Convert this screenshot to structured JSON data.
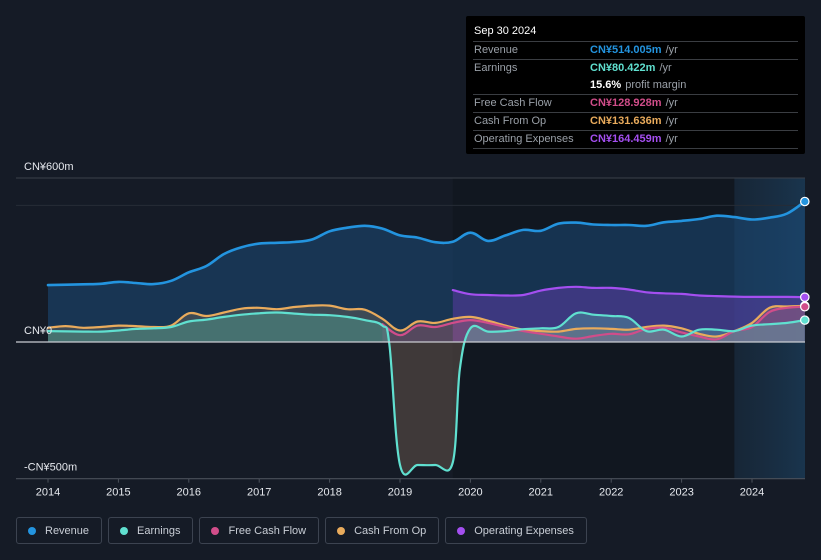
{
  "tooltip": {
    "date": "Sep 30 2024",
    "rows": [
      {
        "label": "Revenue",
        "value": "CN¥514.005m",
        "unit": "/yr",
        "color": "#2394df"
      },
      {
        "label": "Earnings",
        "value": "CN¥80.422m",
        "unit": "/yr",
        "color": "#60e0d0"
      },
      {
        "label": "",
        "margin_value": "15.6%",
        "margin_text": "profit margin"
      },
      {
        "label": "Free Cash Flow",
        "value": "CN¥128.928m",
        "unit": "/yr",
        "color": "#d14d8a"
      },
      {
        "label": "Cash From Op",
        "value": "CN¥131.636m",
        "unit": "/yr",
        "color": "#e9ab5c"
      },
      {
        "label": "Operating Expenses",
        "value": "CN¥164.459m",
        "unit": "/yr",
        "color": "#a44ff0"
      }
    ]
  },
  "legend": [
    {
      "label": "Revenue",
      "color": "#2394df"
    },
    {
      "label": "Earnings",
      "color": "#60e0d0"
    },
    {
      "label": "Free Cash Flow",
      "color": "#d14d8a"
    },
    {
      "label": "Cash From Op",
      "color": "#e9ab5c"
    },
    {
      "label": "Operating Expenses",
      "color": "#a44ff0"
    }
  ],
  "chart_data": {
    "type": "area",
    "title": "",
    "xlabel": "",
    "ylabel": "",
    "y_tick_labels": [
      {
        "value": 600,
        "label": "CN¥600m"
      },
      {
        "value": 0,
        "label": "CN¥0"
      },
      {
        "value": -500,
        "label": "-CN¥500m"
      }
    ],
    "ylim": [
      -500,
      600
    ],
    "xlim": [
      2013.97,
      2024.75
    ],
    "x_tick_labels": [
      "2014",
      "2015",
      "2016",
      "2017",
      "2018",
      "2019",
      "2020",
      "2021",
      "2022",
      "2023",
      "2024"
    ],
    "x_ticks": [
      2014,
      2015,
      2016,
      2017,
      2018,
      2019,
      2020,
      2021,
      2022,
      2023,
      2024
    ],
    "forecast_shade_start": 2023.75,
    "grid": true,
    "legend_position": "bottom",
    "series": [
      {
        "name": "Revenue",
        "color": "#2394df",
        "x": [
          2014.0,
          2014.5,
          2014.75,
          2015.0,
          2015.25,
          2015.5,
          2015.75,
          2016.0,
          2016.25,
          2016.5,
          2016.75,
          2017.0,
          2017.25,
          2017.5,
          2017.75,
          2018.0,
          2018.25,
          2018.5,
          2018.75,
          2019.0,
          2019.25,
          2019.5,
          2019.75,
          2020.0,
          2020.25,
          2020.5,
          2020.75,
          2021.0,
          2021.25,
          2021.5,
          2021.75,
          2022.0,
          2022.25,
          2022.5,
          2022.75,
          2023.0,
          2023.25,
          2023.5,
          2023.75,
          2024.0,
          2024.25,
          2024.5,
          2024.75
        ],
        "values": [
          208,
          211,
          213,
          220,
          216,
          212,
          224,
          255,
          278,
          322,
          347,
          360,
          363,
          366,
          375,
          405,
          418,
          425,
          415,
          390,
          382,
          365,
          367,
          400,
          370,
          390,
          410,
          407,
          433,
          437,
          430,
          428,
          428,
          425,
          438,
          443,
          450,
          462,
          457,
          448,
          455,
          470,
          514
        ]
      },
      {
        "name": "Earnings",
        "color": "#60e0d0",
        "x": [
          2014.0,
          2014.5,
          2014.75,
          2015.0,
          2015.25,
          2015.5,
          2015.75,
          2016.0,
          2016.25,
          2016.5,
          2016.75,
          2017.0,
          2017.25,
          2017.5,
          2017.75,
          2018.0,
          2018.25,
          2018.5,
          2018.75,
          2018.85,
          2019.0,
          2019.25,
          2019.5,
          2019.75,
          2019.85,
          2020.0,
          2020.25,
          2020.5,
          2020.75,
          2021.0,
          2021.25,
          2021.5,
          2021.75,
          2022.0,
          2022.25,
          2022.5,
          2022.75,
          2023.0,
          2023.25,
          2023.5,
          2023.75,
          2024.0,
          2024.25,
          2024.5,
          2024.75
        ],
        "values": [
          40,
          38,
          38,
          42,
          48,
          50,
          55,
          75,
          82,
          92,
          100,
          105,
          108,
          104,
          100,
          98,
          92,
          80,
          60,
          -10,
          -450,
          -450,
          -450,
          -440,
          -100,
          50,
          38,
          40,
          47,
          50,
          55,
          105,
          100,
          95,
          88,
          40,
          45,
          20,
          45,
          45,
          40,
          60,
          65,
          70,
          80
        ]
      },
      {
        "name": "Free Cash Flow",
        "color": "#d14d8a",
        "x": [
          2018.75,
          2019.0,
          2019.25,
          2019.5,
          2019.75,
          2020.0,
          2020.25,
          2020.5,
          2020.75,
          2021.0,
          2021.25,
          2021.5,
          2021.75,
          2022.0,
          2022.25,
          2022.5,
          2022.75,
          2023.0,
          2023.25,
          2023.5,
          2023.75,
          2024.0,
          2024.25,
          2024.5,
          2024.75
        ],
        "values": [
          65,
          25,
          60,
          55,
          70,
          80,
          70,
          55,
          40,
          30,
          20,
          12,
          22,
          30,
          28,
          48,
          52,
          35,
          20,
          10,
          40,
          55,
          110,
          125,
          129
        ]
      },
      {
        "name": "Cash From Op",
        "color": "#e9ab5c",
        "x": [
          2014.0,
          2014.25,
          2014.5,
          2014.75,
          2015.0,
          2015.25,
          2015.5,
          2015.75,
          2016.0,
          2016.25,
          2016.5,
          2016.75,
          2017.0,
          2017.25,
          2017.5,
          2017.75,
          2018.0,
          2018.25,
          2018.5,
          2018.75,
          2019.0,
          2019.25,
          2019.5,
          2019.75,
          2020.0,
          2020.25,
          2020.5,
          2020.75,
          2021.0,
          2021.25,
          2021.5,
          2021.75,
          2022.0,
          2022.25,
          2022.5,
          2022.75,
          2023.0,
          2023.25,
          2023.5,
          2023.75,
          2024.0,
          2024.25,
          2024.5,
          2024.75
        ],
        "values": [
          52,
          58,
          52,
          55,
          60,
          58,
          55,
          60,
          105,
          95,
          108,
          122,
          125,
          120,
          128,
          133,
          133,
          120,
          118,
          85,
          42,
          75,
          70,
          85,
          92,
          78,
          60,
          45,
          40,
          38,
          48,
          50,
          48,
          45,
          55,
          60,
          50,
          30,
          20,
          40,
          70,
          125,
          130,
          132
        ]
      },
      {
        "name": "Operating Expenses",
        "color": "#a44ff0",
        "x": [
          2019.75,
          2020.0,
          2020.25,
          2020.5,
          2020.75,
          2021.0,
          2021.25,
          2021.5,
          2021.75,
          2022.0,
          2022.25,
          2022.5,
          2022.75,
          2023.0,
          2023.25,
          2023.5,
          2023.75,
          2024.0,
          2024.25,
          2024.5,
          2024.75
        ],
        "values": [
          190,
          175,
          172,
          170,
          172,
          188,
          198,
          202,
          198,
          198,
          192,
          182,
          178,
          176,
          170,
          168,
          166,
          165,
          165,
          165,
          164
        ]
      }
    ]
  }
}
